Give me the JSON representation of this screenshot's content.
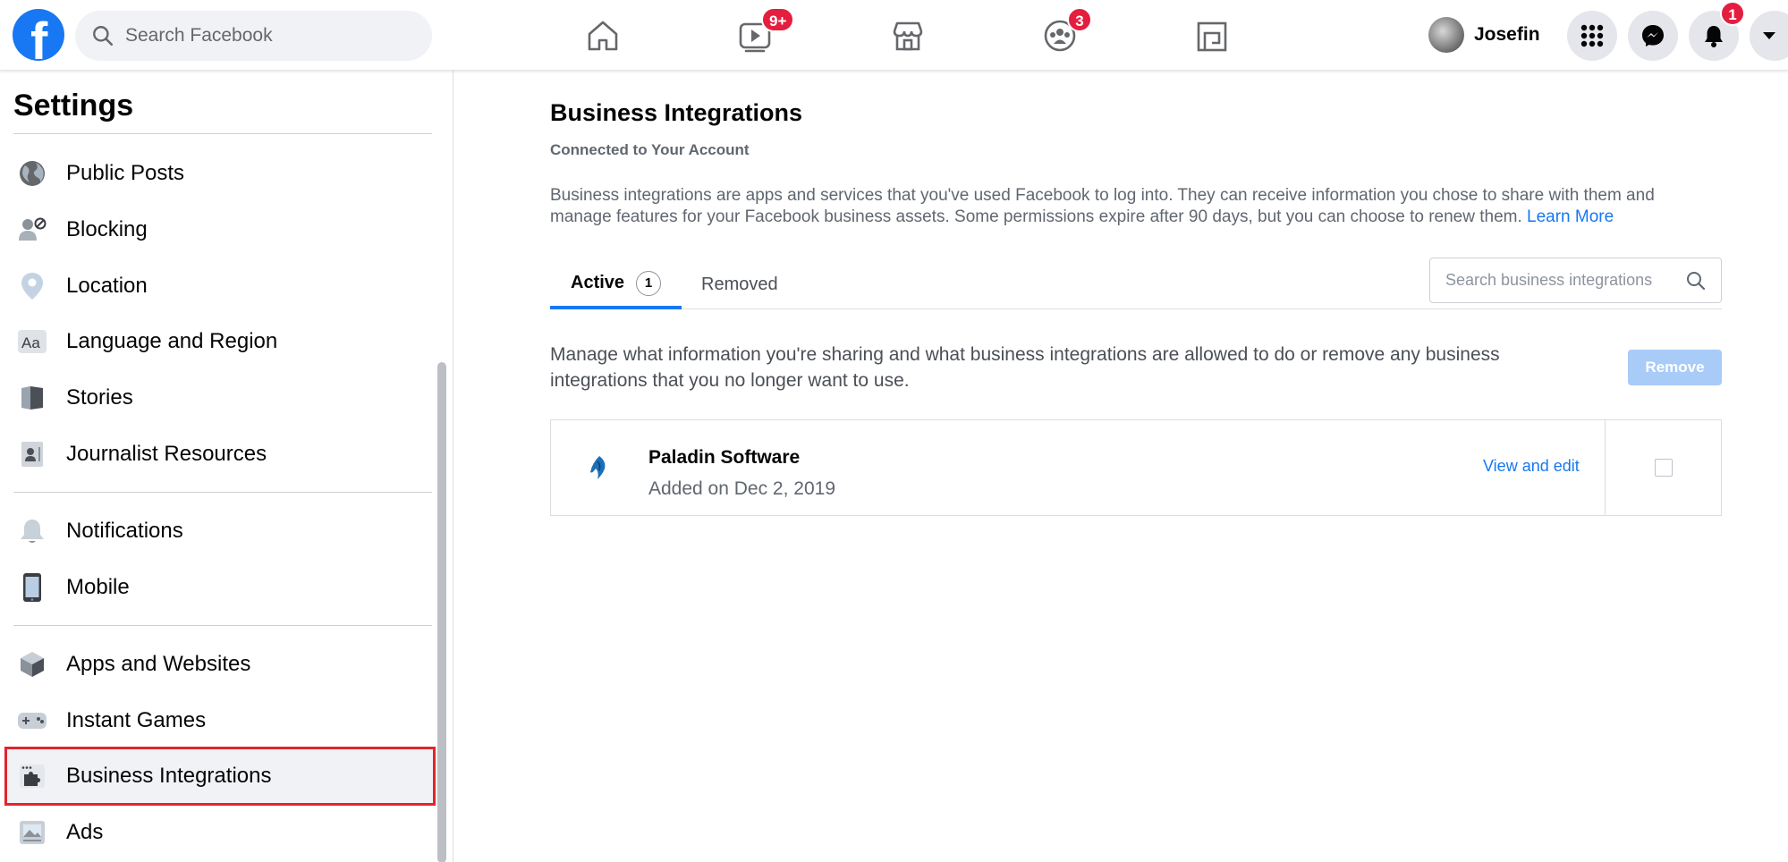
{
  "topbar": {
    "logo_letter": "f",
    "search_placeholder": "Search Facebook",
    "watch_badge": "9+",
    "groups_badge": "3",
    "profile_name": "Josefin",
    "notifications_badge": "1"
  },
  "sidebar": {
    "title": "Settings",
    "items": [
      {
        "label": "Public Posts",
        "icon": "globe-icon"
      },
      {
        "label": "Blocking",
        "icon": "blocked-user-icon"
      },
      {
        "label": "Location",
        "icon": "location-pin-icon"
      },
      {
        "label": "Language and Region",
        "icon": "language-icon"
      },
      {
        "label": "Stories",
        "icon": "book-icon"
      },
      {
        "label": "Journalist Resources",
        "icon": "id-card-icon"
      },
      {
        "label": "Notifications",
        "icon": "bell-icon"
      },
      {
        "label": "Mobile",
        "icon": "phone-icon"
      },
      {
        "label": "Apps and Websites",
        "icon": "cube-icon"
      },
      {
        "label": "Instant Games",
        "icon": "game-controller-icon"
      },
      {
        "label": "Business Integrations",
        "icon": "puzzle-window-icon",
        "active": true
      },
      {
        "label": "Ads",
        "icon": "ad-image-icon"
      }
    ]
  },
  "main": {
    "title": "Business Integrations",
    "subtitle": "Connected to Your Account",
    "description": "Business integrations are apps and services that you've used Facebook to log into. They can receive information you chose to share with them and manage features for your Facebook business assets. Some permissions expire after 90 days, but you can choose to renew them.",
    "learn_more": "Learn More",
    "tabs": [
      {
        "label": "Active",
        "count": "1"
      },
      {
        "label": "Removed"
      }
    ],
    "search_placeholder": "Search business integrations",
    "manage_text": "Manage what information you're sharing and what business integrations are allowed to do or remove any business integrations that you no longer want to use.",
    "remove_label": "Remove",
    "integrations": [
      {
        "name": "Paladin Software",
        "added": "Added on Dec 2, 2019",
        "action": "View and edit"
      }
    ]
  },
  "colors": {
    "brand": "#1877f2",
    "badge": "#e41e3f",
    "highlight": "#e0262d",
    "remove_disabled": "#a8cbf7"
  }
}
